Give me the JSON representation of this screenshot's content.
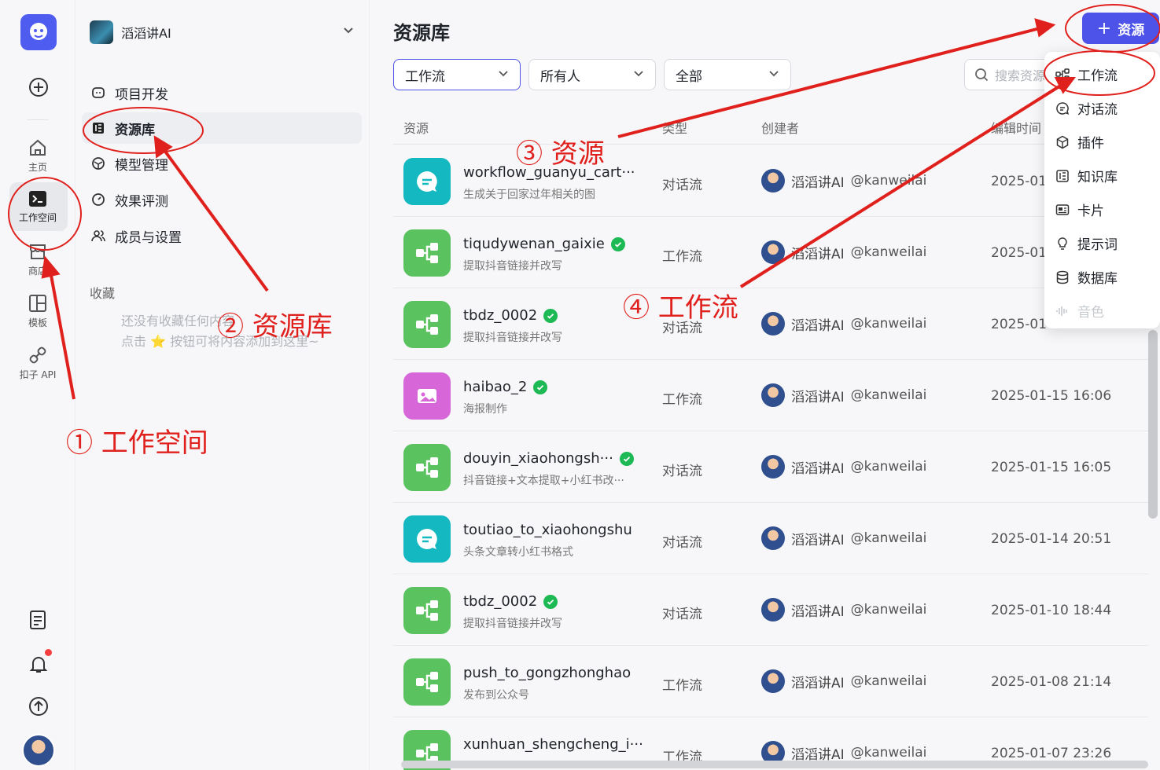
{
  "rail": {
    "items": [
      {
        "label": "主页"
      },
      {
        "label": "工作空间"
      },
      {
        "label": "商店"
      },
      {
        "label": "模板"
      },
      {
        "label": "扣子 API"
      }
    ]
  },
  "sidebar": {
    "workspace_name": "滔滔讲AI",
    "nav": [
      {
        "label": "项目开发"
      },
      {
        "label": "资源库"
      },
      {
        "label": "模型管理"
      },
      {
        "label": "效果评测"
      },
      {
        "label": "成员与设置"
      }
    ],
    "favorites_title": "收藏",
    "favorites_empty_line1": "还没有收藏任何内容",
    "favorites_empty_line2": "点击 ⭐ 按钮可将内容添加到这里~"
  },
  "main": {
    "title": "资源库",
    "add_button": "资源",
    "filters": [
      "工作流",
      "所有人",
      "全部"
    ],
    "search_placeholder": "搜索资源",
    "columns": [
      "资源",
      "类型",
      "创建者",
      "编辑时间"
    ],
    "rows": [
      {
        "name": "workflow_guanyu_cart···",
        "desc": "生成关于回家过年相关的图",
        "type": "对话流",
        "creator": "滔滔讲AI",
        "handle": "@kanweilai",
        "time": "2025-01-",
        "icon": "chat",
        "published": false
      },
      {
        "name": "tiqudywenan_gaixie",
        "desc": "提取抖音链接并改写",
        "type": "工作流",
        "creator": "滔滔讲AI",
        "handle": "@kanweilai",
        "time": "2025-01-",
        "icon": "workflow",
        "published": true
      },
      {
        "name": "tbdz_0002",
        "desc": "提取抖音链接并改写",
        "type": "对话流",
        "creator": "滔滔讲AI",
        "handle": "@kanweilai",
        "time": "2025-01-",
        "icon": "workflow",
        "published": true
      },
      {
        "name": "haibao_2",
        "desc": "海报制作",
        "type": "工作流",
        "creator": "滔滔讲AI",
        "handle": "@kanweilai",
        "time": "2025-01-15 16:06",
        "icon": "image",
        "published": true
      },
      {
        "name": "douyin_xiaohongsh···",
        "desc": "抖音链接+文本提取+小红书改···",
        "type": "对话流",
        "creator": "滔滔讲AI",
        "handle": "@kanweilai",
        "time": "2025-01-15 16:05",
        "icon": "workflow",
        "published": true
      },
      {
        "name": "toutiao_to_xiaohongshu",
        "desc": "头条文章转小红书格式",
        "type": "对话流",
        "creator": "滔滔讲AI",
        "handle": "@kanweilai",
        "time": "2025-01-14 20:51",
        "icon": "chat",
        "published": false
      },
      {
        "name": "tbdz_0002",
        "desc": "提取抖音链接并改写",
        "type": "对话流",
        "creator": "滔滔讲AI",
        "handle": "@kanweilai",
        "time": "2025-01-10 18:44",
        "icon": "workflow",
        "published": true
      },
      {
        "name": "push_to_gongzhonghao",
        "desc": "发布到公众号",
        "type": "工作流",
        "creator": "滔滔讲AI",
        "handle": "@kanweilai",
        "time": "2025-01-08 21:14",
        "icon": "workflow",
        "published": false
      },
      {
        "name": "xunhuan_shengcheng_i···",
        "desc": "",
        "type": "工作流",
        "creator": "滔滔讲AI",
        "handle": "@kanweilai",
        "time": "2025-01-07 23:26",
        "icon": "workflow",
        "published": false
      }
    ]
  },
  "menu": {
    "items": [
      {
        "label": "工作流",
        "icon": "workflow-icon"
      },
      {
        "label": "对话流",
        "icon": "chatflow-icon"
      },
      {
        "label": "插件",
        "icon": "plugin-icon"
      },
      {
        "label": "知识库",
        "icon": "knowledge-icon"
      },
      {
        "label": "卡片",
        "icon": "card-icon"
      },
      {
        "label": "提示词",
        "icon": "prompt-icon"
      },
      {
        "label": "数据库",
        "icon": "database-icon"
      },
      {
        "label": "音色",
        "icon": "voice-icon"
      }
    ]
  },
  "annotations": {
    "step1": "① 工作空间",
    "step2": "② 资源库",
    "step3": "③ 资源",
    "step4": "④ 工作流"
  },
  "colors": {
    "accent": "#4d53e8",
    "annotation": "#e0201c",
    "chat_icon_bg": "#13b8c0",
    "workflow_icon_bg": "#5ac35f",
    "image_icon_bg": "#d766d9"
  }
}
